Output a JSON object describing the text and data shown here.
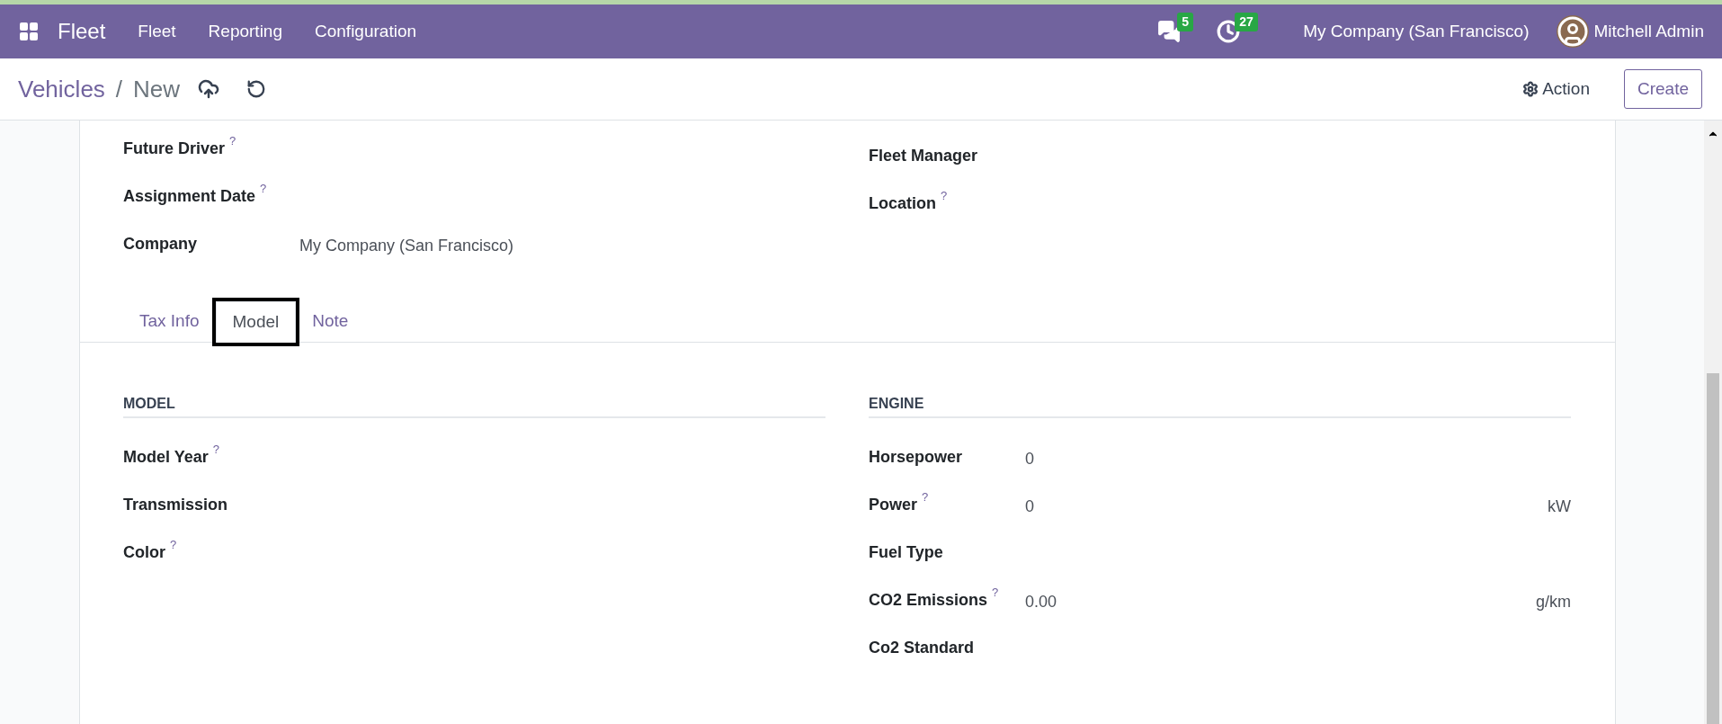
{
  "navbar": {
    "app_name": "Fleet",
    "menu": [
      "Fleet",
      "Reporting",
      "Configuration"
    ],
    "messages_count": "5",
    "activities_count": "27",
    "company": "My Company (San Francisco)",
    "user": "Mitchell Admin"
  },
  "breadcrumb": {
    "parent": "Vehicles",
    "separator": "/",
    "current": "New"
  },
  "actions": {
    "action": "Action",
    "create": "Create"
  },
  "top_fields": {
    "left": [
      {
        "label": "Future Driver",
        "help": "?"
      },
      {
        "label": "Assignment Date",
        "help": "?"
      },
      {
        "label": "Company",
        "value": "My Company (San Francisco)"
      }
    ],
    "right": [
      {
        "label": "Fleet Manager"
      },
      {
        "label": "Location",
        "help": "?"
      }
    ]
  },
  "tabs": [
    {
      "label": "Tax Info",
      "selected": false,
      "highlighted": false
    },
    {
      "label": "Model",
      "selected": true,
      "highlighted": true
    },
    {
      "label": "Note",
      "selected": false,
      "highlighted": false
    }
  ],
  "model_section": {
    "title": "MODEL",
    "fields": [
      {
        "label": "Model Year",
        "help": "?"
      },
      {
        "label": "Transmission"
      },
      {
        "label": "Color",
        "help": "?"
      }
    ]
  },
  "engine_section": {
    "title": "ENGINE",
    "fields": [
      {
        "label": "Horsepower",
        "value": "0"
      },
      {
        "label": "Power",
        "help": "?",
        "value": "0",
        "unit": "kW"
      },
      {
        "label": "Fuel Type"
      },
      {
        "label": "CO2 Emissions",
        "help": "?",
        "value": "0.00",
        "unit": "g/km"
      },
      {
        "label": "Co2 Standard"
      }
    ]
  }
}
